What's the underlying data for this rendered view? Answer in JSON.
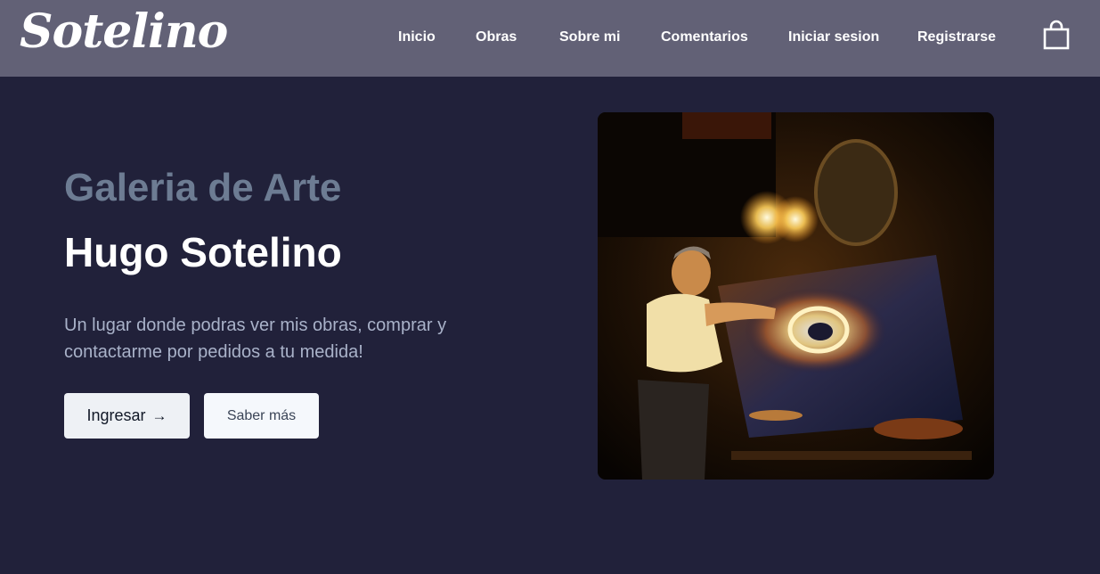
{
  "brand": {
    "name": "Sotelino"
  },
  "nav": {
    "items": [
      {
        "label": "Inicio"
      },
      {
        "label": "Obras"
      },
      {
        "label": "Sobre mi"
      },
      {
        "label": "Comentarios"
      },
      {
        "label": "Iniciar sesion"
      },
      {
        "label": "Registrarse"
      }
    ],
    "cart_icon": "shopping-bag-icon"
  },
  "hero": {
    "kicker": "Galeria de Arte",
    "title": "Hugo Sotelino",
    "description": "Un lugar donde podras ver mis obras, comprar y contactarme por pedidos a tu medida!",
    "primary_button": {
      "label": "Ingresar",
      "icon": "arrow-right-icon"
    },
    "secondary_button": {
      "label": "Saber más"
    }
  },
  "colors": {
    "navbar": "#626176",
    "background": "#21213a",
    "kicker": "#6d7c93",
    "description": "#a9b2c9"
  }
}
